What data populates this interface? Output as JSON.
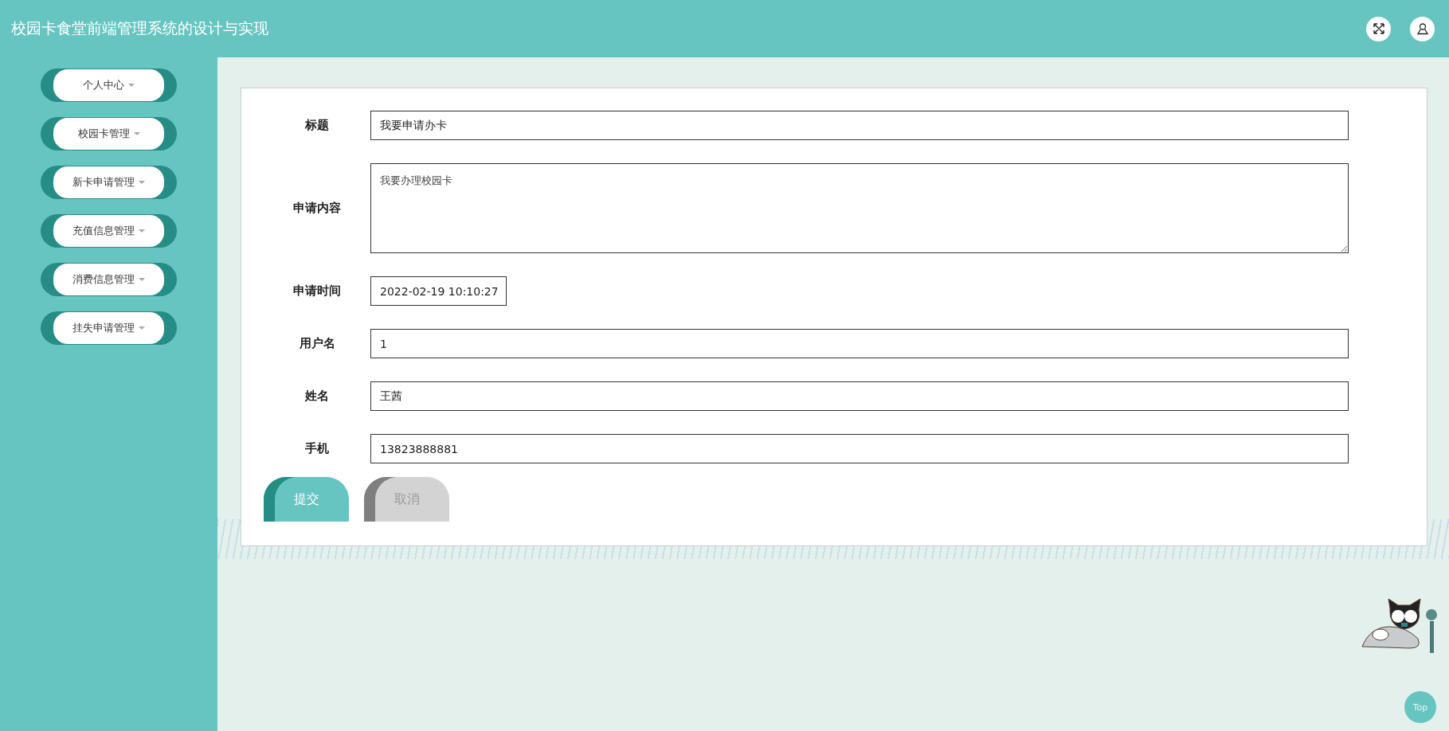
{
  "header": {
    "title": "校园卡食堂前端管理系统的设计与实现"
  },
  "sidebar": {
    "items": [
      {
        "label": "个人中心"
      },
      {
        "label": "校园卡管理"
      },
      {
        "label": "新卡申请管理"
      },
      {
        "label": "充值信息管理"
      },
      {
        "label": "消费信息管理"
      },
      {
        "label": "挂失申请管理"
      }
    ]
  },
  "form": {
    "fields": [
      {
        "kind": "input",
        "label": "标题",
        "value": "我要申请办卡"
      },
      {
        "kind": "textarea",
        "label": "申请内容",
        "value": "我要办理校园卡"
      },
      {
        "kind": "date",
        "label": "申请时间",
        "value": "2022-02-19 10:10:27"
      },
      {
        "kind": "input",
        "label": "用户名",
        "value": "1"
      },
      {
        "kind": "input",
        "label": "姓名",
        "value": "王茜"
      },
      {
        "kind": "input",
        "label": "手机",
        "value": "13823888881"
      }
    ],
    "buttons": [
      {
        "kind": "primary",
        "label": "提交"
      },
      {
        "kind": "secondary",
        "label": "取消"
      }
    ]
  },
  "back_to_top": {
    "label": "Top"
  }
}
